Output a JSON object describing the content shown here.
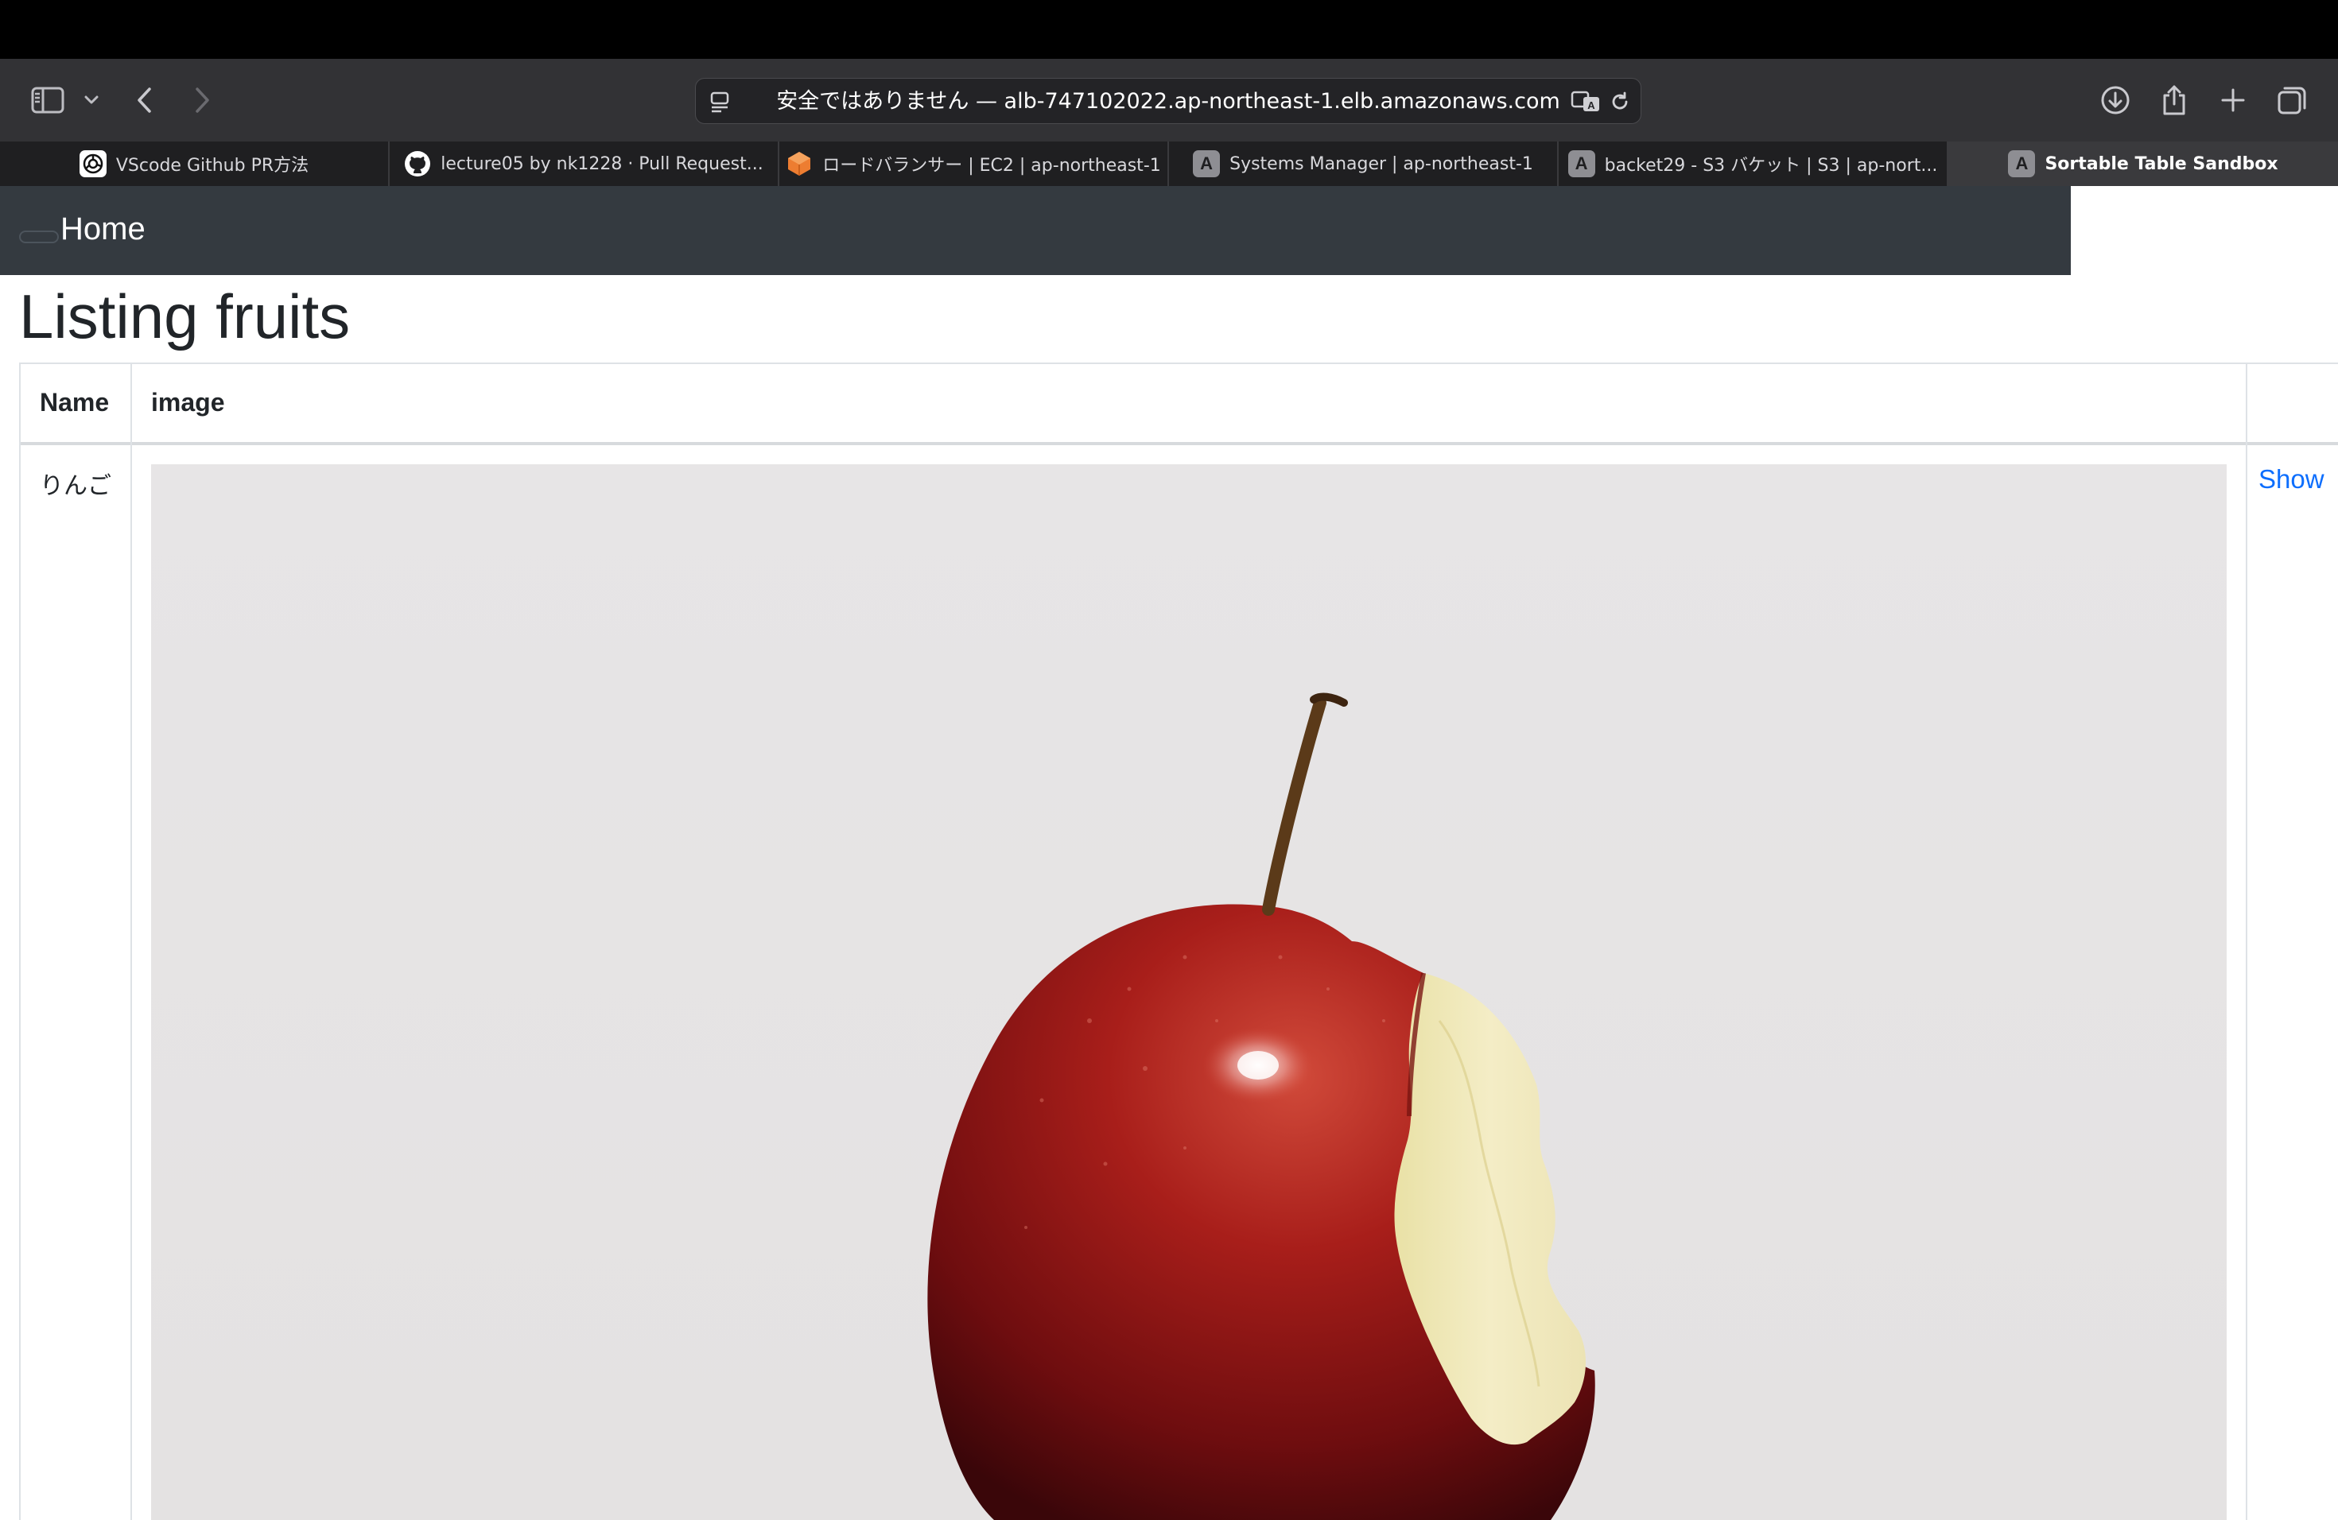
{
  "browser": {
    "address_text": "安全ではありません — alb-747102022.ap-northeast-1.elb.amazonaws.com",
    "tabs": [
      {
        "label": "VScode Github PR方法",
        "icon": "openai-icon"
      },
      {
        "label": "lecture05 by nk1228 · Pull Request...",
        "icon": "github-icon"
      },
      {
        "label": "ロードバランサー | EC2 | ap-northeast-1",
        "icon": "aws-ec2-icon"
      },
      {
        "label": "Systems Manager | ap-northeast-1",
        "icon": "letter-a-icon",
        "letter": "A"
      },
      {
        "label": "backet29 - S3 バケット | S3 | ap-nort...",
        "icon": "letter-a-icon",
        "letter": "A"
      },
      {
        "label": "Sortable Table Sandbox",
        "icon": "letter-a-icon",
        "letter": "A",
        "active": true
      }
    ]
  },
  "page": {
    "nav_home": "Home",
    "title": "Listing fruits",
    "table": {
      "headers": [
        "Name",
        "image"
      ],
      "rows": [
        {
          "name": "りんご",
          "image": "apple-photo",
          "action": "Show"
        }
      ]
    }
  },
  "colors": {
    "nav_bg": "#343a40",
    "link": "#0d6efd",
    "toolbar_bg": "#323235"
  }
}
